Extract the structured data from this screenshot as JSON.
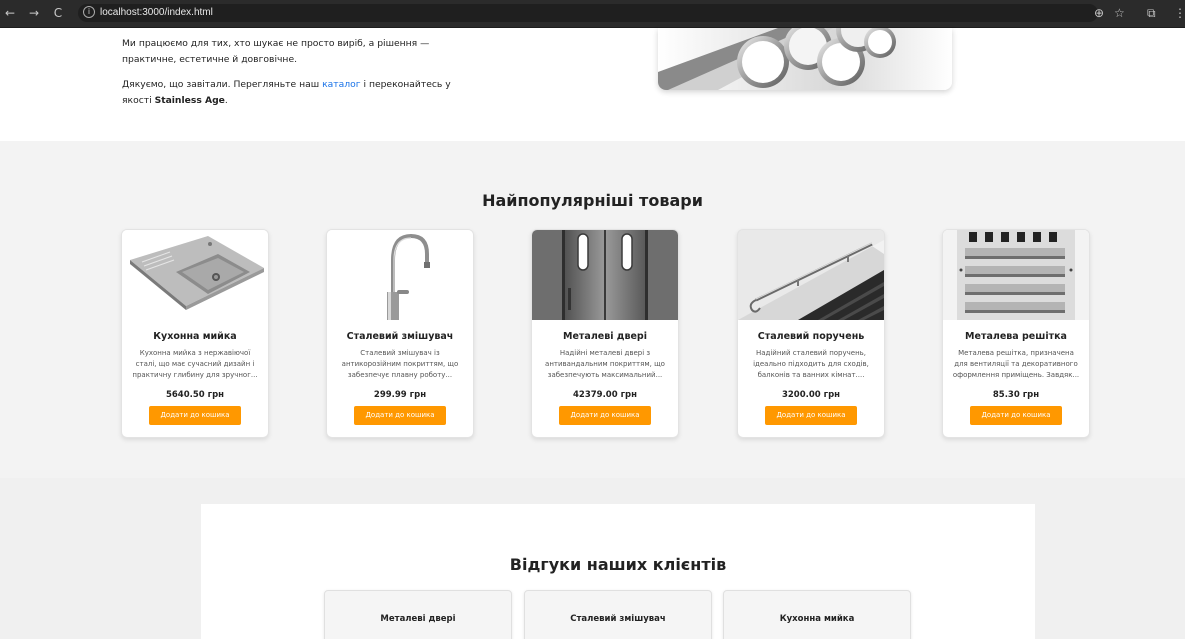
{
  "browser": {
    "url": "localhost:3000/index.html",
    "back_icon": "←",
    "forward_icon": "→",
    "reload_icon": "C",
    "info_icon": "i",
    "zoom_icon": "⊕",
    "star_icon": "☆",
    "extensions_icon": "⧉",
    "menu_icon": "⋮"
  },
  "intro": {
    "p1": "Ми працюємо для тих, хто шукає не просто виріб, а рішення — практичне, естетичне й довговічне.",
    "p2_before": "Дякуємо, що завітали. Перегляньте наш",
    "p2_link": "каталог",
    "p2_after": "і переконайтесь у якості",
    "brand": "Stainless Age",
    "p2_end": "."
  },
  "products": {
    "title": "Найпопулярніші товари",
    "items": [
      {
        "title": "Кухонна мийка",
        "desc": "Кухонна мийка з нержавіючої сталі, що має сучасний дизайн і практичну глибину для зручног...",
        "price": "5640.50 грн",
        "button": "Додати до кошика",
        "icon": "sink-image"
      },
      {
        "title": "Сталевий змішувач",
        "desc": "Сталевий змішувач із антикорозійним покриттям, що забезпечує плавну роботу...",
        "price": "299.99 грн",
        "button": "Додати до кошика",
        "icon": "faucet-image"
      },
      {
        "title": "Металеві двері",
        "desc": "Надійні металеві двері з антивандальним покриттям, що забезпечують максимальний...",
        "price": "42379.00 грн",
        "button": "Додати до кошика",
        "icon": "door-image"
      },
      {
        "title": "Сталевий поручень",
        "desc": "Надійний сталевий поручень, ідеально підходить для сходів, балконів та ванних кімнат....",
        "price": "3200.00 грн",
        "button": "Додати до кошика",
        "icon": "handrail-image"
      },
      {
        "title": "Металева решітка",
        "desc": "Металева решітка, призначена для вентиляції та декоративного оформлення приміщень. Завдяк...",
        "price": "85.30 грн",
        "button": "Додати до кошика",
        "icon": "grille-image"
      }
    ]
  },
  "reviews": {
    "title": "Відгуки наших клієнтів",
    "items": [
      {
        "title": "Металеві двері"
      },
      {
        "title": "Сталевий змішувач"
      },
      {
        "title": "Кухонна мийка"
      }
    ]
  },
  "colors": {
    "accent": "#ff9800",
    "link": "#1a73e8",
    "page_bg": "#f3f3f3"
  }
}
